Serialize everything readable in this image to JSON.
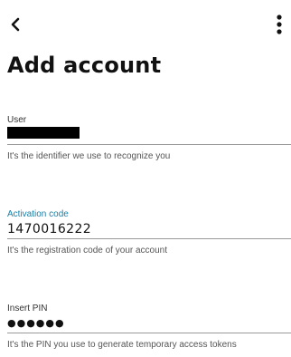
{
  "header": {
    "back_icon": "chevron-left-icon",
    "menu_icon": "more-vertical-icon"
  },
  "page": {
    "title": "Add account"
  },
  "fields": {
    "user": {
      "label": "User",
      "value": "",
      "redacted": true,
      "helper": "It's the identifier we use to recognize you"
    },
    "activation": {
      "label": "Activation code",
      "value": "1470016222",
      "helper": "It's the registration code of your account",
      "label_color": "#1a7fa6"
    },
    "pin": {
      "label": "Insert PIN",
      "value": "●●●●●●",
      "helper": "It's the PIN you use to generate temporary access tokens"
    }
  }
}
